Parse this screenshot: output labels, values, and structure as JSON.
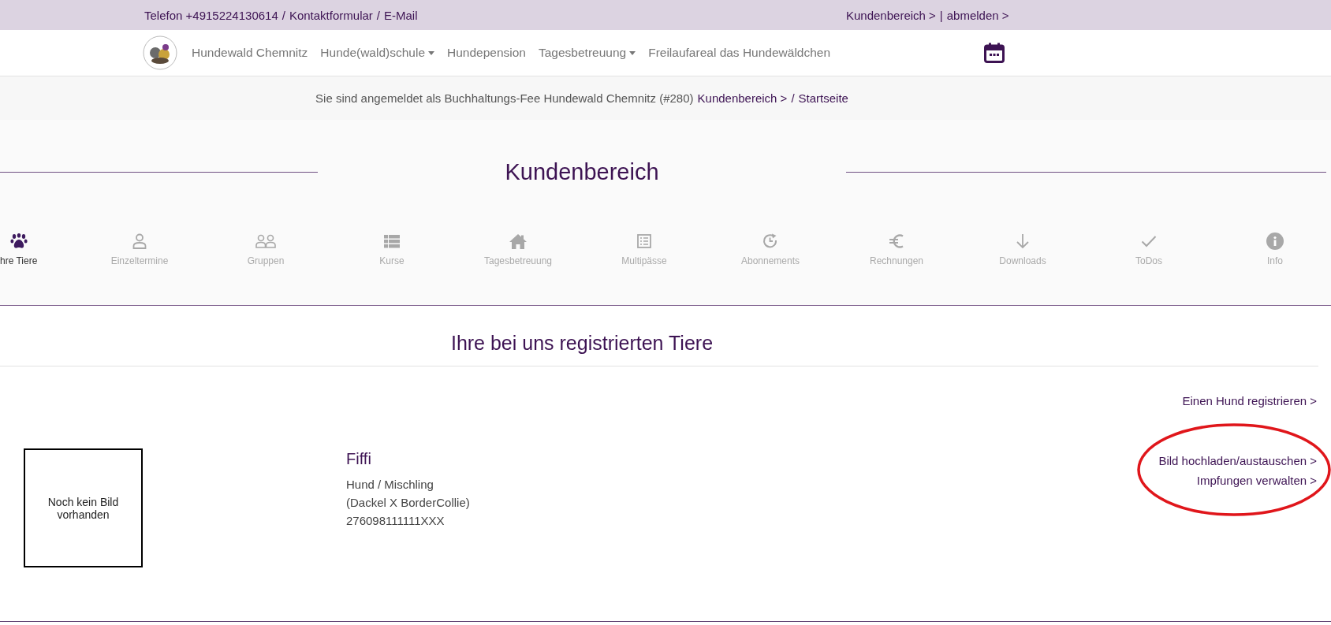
{
  "top_bar": {
    "left": {
      "links": [
        "Telefon +4915224130614",
        "Kontaktformular",
        "E-Mail"
      ],
      "separator": "/"
    },
    "right": {
      "links": [
        "Kundenbereich >",
        "abmelden >"
      ],
      "separator": "|"
    }
  },
  "nav": {
    "items": [
      {
        "label": "Hundewald Chemnitz",
        "dropdown": false
      },
      {
        "label": "Hunde(wald)schule",
        "dropdown": true
      },
      {
        "label": "Hundepension",
        "dropdown": false
      },
      {
        "label": "Tagesbetreuung",
        "dropdown": true
      },
      {
        "label": "Freilaufareal das Hundewäldchen",
        "dropdown": false
      }
    ]
  },
  "breadcrumb": {
    "intro": "Sie sind angemeldet als Buchhaltungs-Fee Hundewald Chemnitz (#280)",
    "trail": {
      "links": [
        "Kundenbereich >",
        "Startseite"
      ],
      "separator": "/"
    }
  },
  "page_title": "Kundenbereich",
  "tabs": [
    {
      "label": "hre Tiere",
      "selected": true
    },
    {
      "label": "Einzeltermine",
      "selected": false
    },
    {
      "label": "Gruppen",
      "selected": false
    },
    {
      "label": "Kurse",
      "selected": false
    },
    {
      "label": "Tagesbetreuung",
      "selected": false
    },
    {
      "label": "Multipässe",
      "selected": false
    },
    {
      "label": "Abonnements",
      "selected": false
    },
    {
      "label": "Rechnungen",
      "selected": false
    },
    {
      "label": "Downloads",
      "selected": false
    },
    {
      "label": "ToDos",
      "selected": false
    },
    {
      "label": "Info",
      "selected": false
    }
  ],
  "section_title": "Ihre bei uns registrierten Tiere",
  "register_link": "Einen Hund registrieren >",
  "animals": [
    {
      "name": "Fiffi",
      "no_image_text": "Noch kein Bild vorhanden",
      "details": [
        "Hund / Mischling",
        "(Dackel X BorderCollie)",
        "276098111111XXX"
      ],
      "actions": [
        "Bild hochladen/austauschen >",
        "Impfungen verwalten >"
      ]
    }
  ]
}
